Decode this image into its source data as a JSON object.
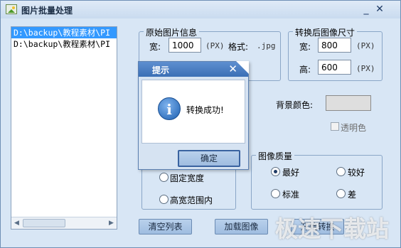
{
  "window": {
    "title": "图片批量处理",
    "minimize_glyph": "_",
    "close_glyph": "✕"
  },
  "file_list": {
    "items": [
      "D:\\backup\\教程素材\\PI",
      "D:\\backup\\教程素材\\PI"
    ],
    "scroll_left": "◀",
    "scroll_right": "▶"
  },
  "original_info": {
    "group_title": "原始图片信息",
    "width_label": "宽:",
    "width_value": "1000",
    "px_unit": "(PX)",
    "format_label": "格式:",
    "format_value": ".jpg"
  },
  "resize": {
    "group_title": "转换后图像尺寸",
    "width_label": "宽:",
    "width_value": "800",
    "height_label": "高:",
    "height_value": "600",
    "px_unit": "(PX)"
  },
  "background": {
    "label": "背景颜色:",
    "swatch_color": "#dedede",
    "transparent_label": "透明色",
    "transparent_checked": false
  },
  "scale_mode": {
    "options": [
      {
        "label": "固定宽度",
        "selected": false
      },
      {
        "label": "高宽范围内",
        "selected": false
      }
    ]
  },
  "quality": {
    "group_title": "图像质量",
    "options": [
      {
        "label": "最好",
        "selected": true
      },
      {
        "label": "较好",
        "selected": false
      },
      {
        "label": "标准",
        "selected": false
      },
      {
        "label": "差",
        "selected": false
      }
    ]
  },
  "buttons": {
    "clear_list": "清空列表",
    "load_image": "加载图像",
    "start_convert": "开始转换"
  },
  "dialog": {
    "title": "提示",
    "close_glyph": "✕",
    "message": "转换成功!",
    "ok_label": "确定"
  },
  "watermark": "极速下载站",
  "colors": {
    "window_bg": "#d8e6f5",
    "dialog_titlebar": "#3b6fb5",
    "selection": "#3399ff"
  }
}
